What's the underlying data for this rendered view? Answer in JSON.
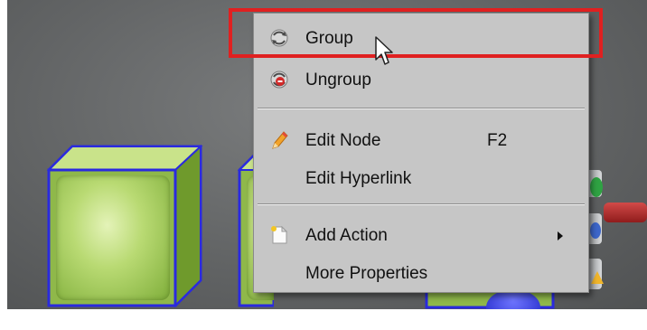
{
  "menu": {
    "items": [
      {
        "label": "Group",
        "shortcut": "",
        "submenu": false,
        "icon": "group-icon"
      },
      {
        "label": "Ungroup",
        "shortcut": "",
        "submenu": false,
        "icon": "ungroup-icon"
      },
      {
        "label": "Edit Node",
        "shortcut": "F2",
        "submenu": false,
        "icon": "pencil-icon"
      },
      {
        "label": "Edit Hyperlink",
        "shortcut": "",
        "submenu": false,
        "icon": ""
      },
      {
        "label": "Add Action",
        "shortcut": "",
        "submenu": true,
        "icon": "document-icon"
      },
      {
        "label": "More Properties",
        "shortcut": "",
        "submenu": false,
        "icon": ""
      }
    ],
    "highlighted_item": "Group"
  },
  "colors": {
    "viewport_background": "#626465",
    "cube_green": "#b9da73",
    "selection_outline": "#2a2adf",
    "menu_background": "#c6c6c6",
    "annotation_red": "#e02020"
  }
}
